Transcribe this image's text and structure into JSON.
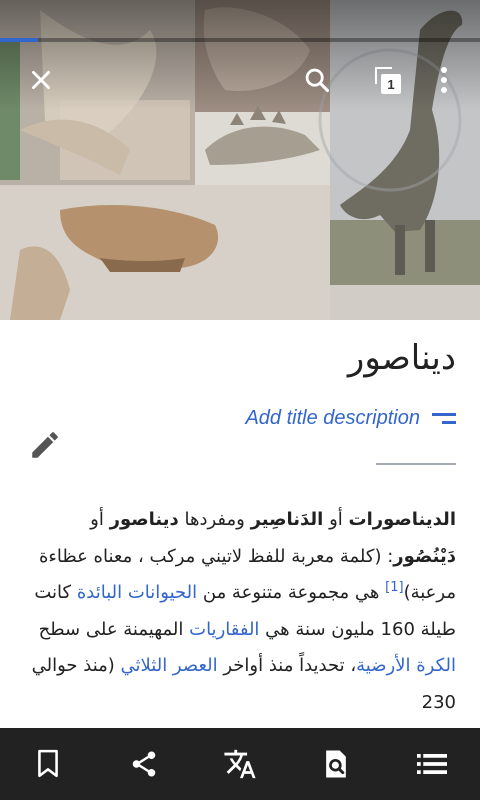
{
  "toolbar_top": {
    "tabs_count": "1"
  },
  "load_progress": 0.08,
  "article": {
    "title": "ديناصور",
    "add_description": "Add title description",
    "intro": {
      "bold_1": "الديناصورات",
      "t1": " أو ",
      "bold_2": "الدَناصِير",
      "t2": " ومفردها ",
      "bold_3": "ديناصور",
      "t3": " أو ",
      "bold_4": "دَيْنُصُور",
      "t4": ": (كلمة معربة للفظ لاتيني مركب ، معناه عظاءة مرعبة)",
      "ref": "[1]",
      "t5": " هي مجموعة متنوعة من ",
      "link_1": "الحيوانات البائدة",
      "t6": " كانت طيلة 160 مليون سنة هي ",
      "link_2": "الفقاريات",
      "t7": " المهيمنة على سطح ",
      "link_3": "الكرة الأرضية",
      "t8": "، تحديداً منذ أواخر ",
      "link_4": "العصر الثلاثي",
      "t9": " (منذ حوالي 230"
    }
  },
  "bottom_toolbar": [
    "bookmark-icon",
    "share-icon",
    "translate-icon",
    "find-in-page-icon",
    "table-of-contents-icon"
  ],
  "colors": {
    "link": "#3366cc",
    "toolbar": "#222222",
    "text": "#222222"
  }
}
